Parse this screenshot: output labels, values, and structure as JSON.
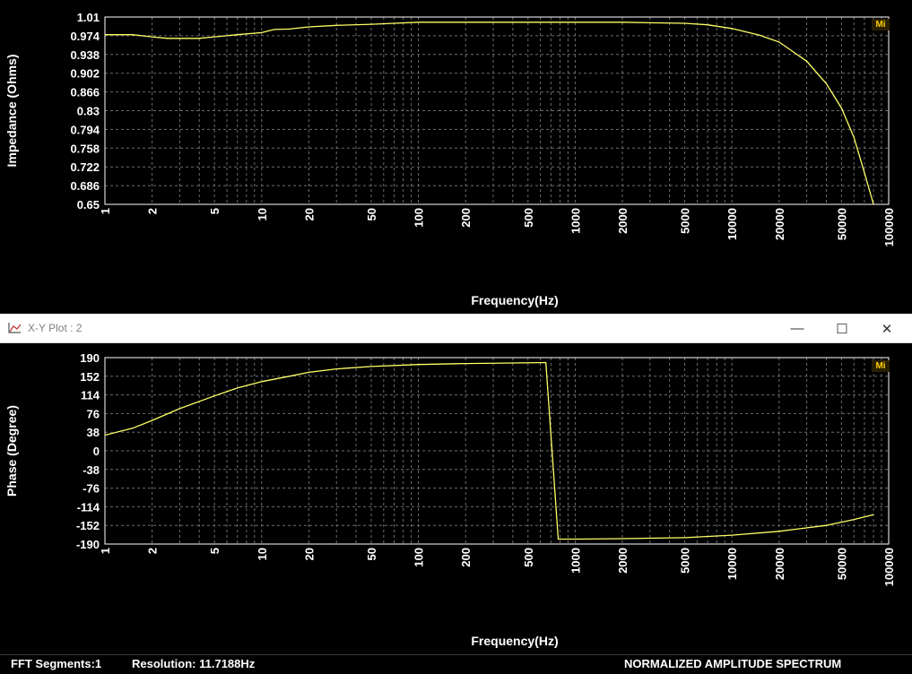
{
  "window": {
    "title": "X-Y Plot : 2",
    "minimize": "—",
    "maximize": "☐",
    "close": "✕"
  },
  "status": {
    "segments": "FFT Segments:1",
    "resolution": "Resolution: 11.7188Hz",
    "spectrum": "NORMALIZED AMPLITUDE SPECTRUM"
  },
  "badge": "Mi",
  "colors": {
    "trace": "#ffff66",
    "grid": "#6e6e6e",
    "axis": "#ffffff",
    "background": "#000000"
  },
  "chart_data": [
    {
      "type": "line",
      "xlabel": "Frequency(Hz)",
      "ylabel": "Impedance (Ohms)",
      "xscale": "log",
      "xlim": [
        1,
        100000
      ],
      "ylim": [
        0.65,
        1.01
      ],
      "xticks": [
        "1",
        "2",
        "5",
        "10",
        "20",
        "50",
        "100",
        "200",
        "500",
        "1000",
        "2000",
        "5000",
        "10000",
        "20000",
        "50000",
        "100000"
      ],
      "yticks": [
        "1.01",
        "0.974",
        "0.938",
        "0.902",
        "0.866",
        "0.83",
        "0.794",
        "0.758",
        "0.722",
        "0.686",
        "0.65"
      ],
      "grid": true,
      "x": [
        1,
        1.5,
        2,
        2.5,
        3,
        4,
        5,
        7,
        10,
        12,
        15,
        20,
        30,
        50,
        70,
        100,
        200,
        500,
        1000,
        2000,
        3000,
        5000,
        7000,
        10000,
        15000,
        20000,
        30000,
        40000,
        50000,
        60000,
        70000,
        80000
      ],
      "y": [
        0.976,
        0.976,
        0.972,
        0.969,
        0.969,
        0.969,
        0.972,
        0.976,
        0.98,
        0.986,
        0.987,
        0.991,
        0.994,
        0.996,
        0.998,
        1.0,
        1.0,
        1.0,
        1.0,
        1.0,
        0.999,
        0.998,
        0.995,
        0.988,
        0.975,
        0.962,
        0.925,
        0.882,
        0.835,
        0.779,
        0.711,
        0.65
      ]
    },
    {
      "type": "line",
      "xlabel": "Frequency(Hz)",
      "ylabel": "Phase (Degree)",
      "xscale": "log",
      "xlim": [
        1,
        100000
      ],
      "ylim": [
        -190,
        190
      ],
      "xticks": [
        "1",
        "2",
        "5",
        "10",
        "20",
        "50",
        "100",
        "200",
        "500",
        "1000",
        "2000",
        "5000",
        "10000",
        "20000",
        "50000",
        "100000"
      ],
      "yticks": [
        "190",
        "152",
        "114",
        "76",
        "38",
        "0",
        "-38",
        "-76",
        "-114",
        "-152",
        "-190"
      ],
      "grid": true,
      "x": [
        1,
        1.5,
        2,
        3,
        5,
        7,
        10,
        15,
        20,
        30,
        50,
        100,
        200,
        400,
        650,
        780,
        1000,
        2000,
        5000,
        10000,
        20000,
        40000,
        60000,
        80000
      ],
      "y": [
        32,
        46,
        62,
        86,
        112,
        128,
        141,
        152,
        160,
        167,
        172,
        176,
        178,
        179,
        180,
        -180,
        -180,
        -179,
        -177,
        -172,
        -164,
        -152,
        -140,
        -130
      ]
    }
  ]
}
